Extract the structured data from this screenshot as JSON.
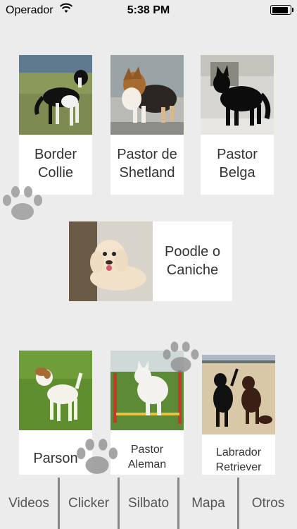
{
  "status_bar": {
    "carrier": "Operador",
    "time": "5:38 PM",
    "battery_level": 0.95
  },
  "breeds": [
    {
      "label_line1": "Border",
      "label_line2": "Collie",
      "photo": "border-collie-photo"
    },
    {
      "label_line1": "Pastor de",
      "label_line2": "Shetland",
      "photo": "shetland-photo"
    },
    {
      "label_line1": "Pastor",
      "label_line2": "Belga",
      "photo": "pastor-belga-photo"
    },
    {
      "label_line1": "Poodle o",
      "label_line2": "Caniche",
      "photo": "poodle-photo"
    },
    {
      "label_line1": "Parson",
      "label_line2": "",
      "photo": "parson-photo"
    },
    {
      "label_line1": "Pastor",
      "label_line2": "Aleman",
      "photo": "pastor-aleman-photo"
    },
    {
      "label_line1": "Labrador",
      "label_line2": "Retriever",
      "photo": "labrador-photo"
    }
  ],
  "tabs": [
    "Videos",
    "Clicker",
    "Silbato",
    "Mapa",
    "Otros"
  ]
}
